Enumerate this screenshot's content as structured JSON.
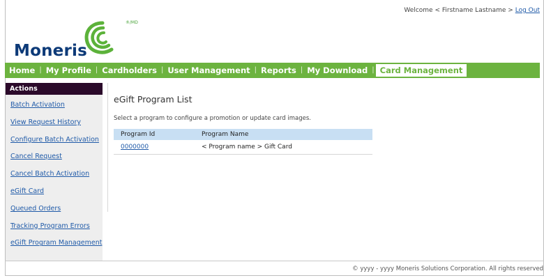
{
  "header": {
    "welcome_text": "Welcome < Firstname Lastname >",
    "logout_label": "Log Out",
    "logo_text": "Moneris",
    "logo_mark": "®/MD"
  },
  "topnav": {
    "items": [
      {
        "label": "Home"
      },
      {
        "label": "My Profile"
      },
      {
        "label": "Cardholders"
      },
      {
        "label": "User Management"
      },
      {
        "label": "Reports"
      },
      {
        "label": "My Download"
      },
      {
        "label": "Card Management",
        "active": true
      }
    ]
  },
  "sidebar": {
    "title": "Actions",
    "items": [
      {
        "label": "Batch Activation"
      },
      {
        "label": "View Request History"
      },
      {
        "label": "Configure Batch Activation"
      },
      {
        "label": "Cancel Request"
      },
      {
        "label": "Cancel Batch Activation"
      },
      {
        "label": "eGift Card"
      },
      {
        "label": "Queued Orders"
      },
      {
        "label": "Tracking Program Errors"
      },
      {
        "label": "eGift Program Management"
      }
    ]
  },
  "main": {
    "title": "eGift Program List",
    "description": "Select a program to configure a promotion or update card images.",
    "table": {
      "headers": [
        "Program Id",
        "Program Name"
      ],
      "rows": [
        {
          "program_id": "0000000",
          "program_name": "< Program name > Gift Card"
        }
      ]
    }
  },
  "footer": {
    "text": "© yyyy - yyyy  Moneris Solutions Corporation. All rights reserved"
  },
  "colors": {
    "nav_green": "#6cb33f",
    "sidebar_header": "#2b0a2a",
    "link_blue": "#1f5aa8",
    "table_header": "#c8dff3",
    "brand_navy": "#0d3a78"
  }
}
